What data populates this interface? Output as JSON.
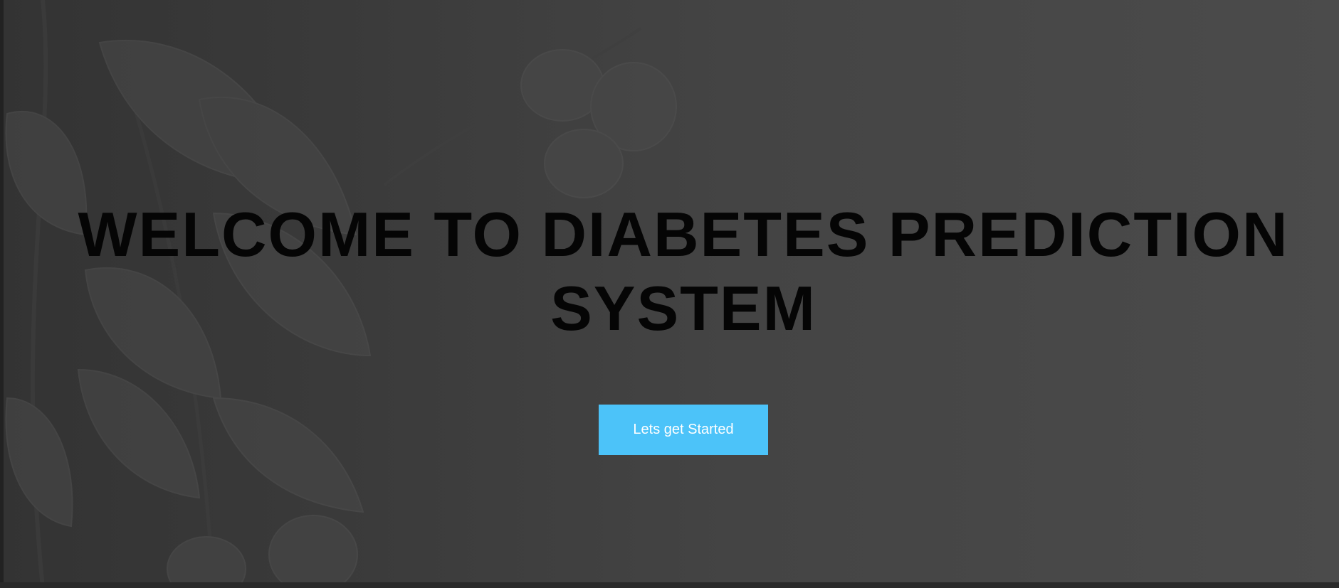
{
  "hero": {
    "title_line1": "WELCOME TO DIABETES PREDICTION",
    "title_line2": "SYSTEM",
    "cta_label": "Lets get Started",
    "background_image": "botanical-leaves-and-fruit-illustration"
  },
  "colors": {
    "background": "#444444",
    "title": "#050505",
    "cta_background": "#4cc3f9",
    "cta_text": "#ffffff"
  }
}
